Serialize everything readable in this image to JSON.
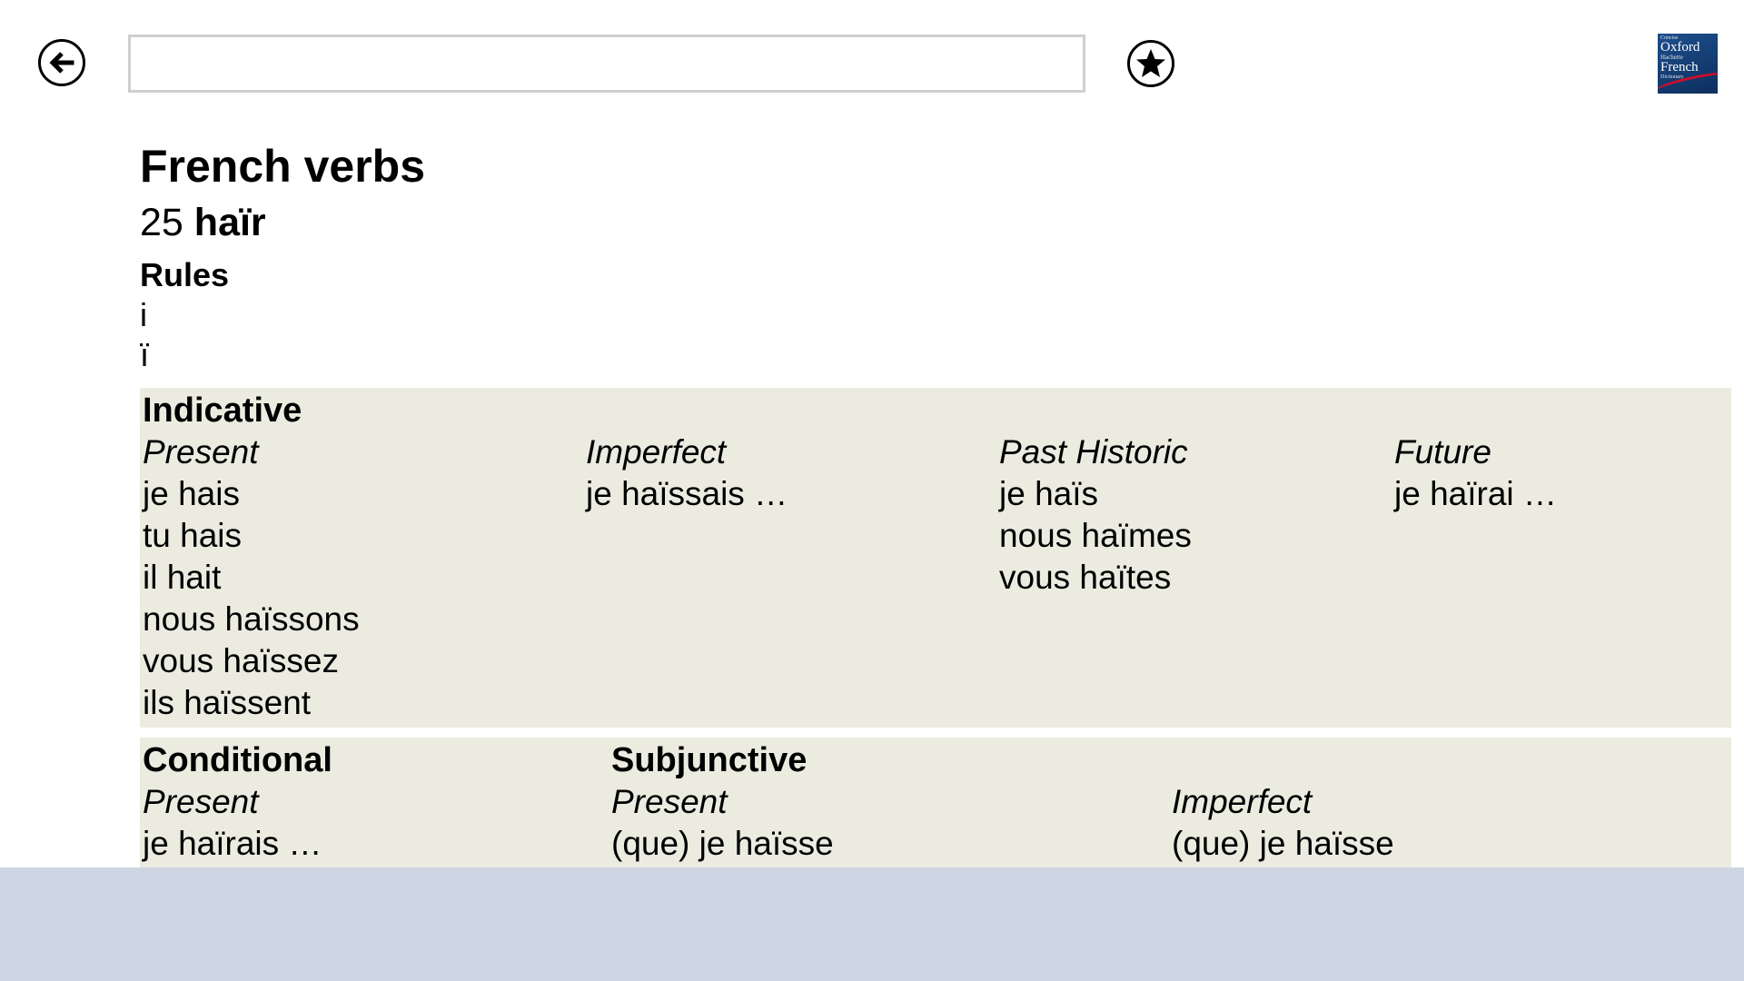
{
  "search": {
    "value": "",
    "placeholder": ""
  },
  "logo": {
    "line1": "Concise",
    "line2": "Oxford",
    "line3": "Hachette",
    "line4": "French",
    "line5": "Dictionary"
  },
  "page": {
    "title": "French verbs",
    "verb_number": "25",
    "verb": "haïr",
    "rules_title": "Rules",
    "rules": [
      "i",
      "ï"
    ]
  },
  "indicative": {
    "title": "Indicative",
    "present": {
      "label": "Present",
      "forms": [
        "je hais",
        "tu hais",
        "il hait",
        "nous haïssons",
        "vous haïssez",
        "ils haïssent"
      ]
    },
    "imperfect": {
      "label": "Imperfect",
      "forms": [
        "je haïssais …"
      ]
    },
    "past_historic": {
      "label": "Past Historic",
      "forms": [
        "je haïs",
        "nous haïmes",
        "vous haïtes"
      ]
    },
    "future": {
      "label": "Future",
      "forms": [
        "je haïrai …"
      ]
    }
  },
  "conditional": {
    "title": "Conditional",
    "present": {
      "label": "Present",
      "forms": [
        "je haïrais …"
      ]
    }
  },
  "subjunctive": {
    "title": "Subjunctive",
    "present": {
      "label": "Present",
      "forms": [
        "(que) je haïsse"
      ]
    },
    "imperfect": {
      "label": "Imperfect",
      "forms": [
        "(que) je haïsse"
      ]
    }
  },
  "icons": {
    "back": "arrow-left-circle-icon",
    "favorite": "star-circle-icon"
  },
  "colors": {
    "panel_bg": "#ecebe0",
    "footer_bg": "#cdd5e3",
    "search_border": "#cfcfcf",
    "logo_blue": "#1d4f8c",
    "logo_red": "#c8102e"
  }
}
